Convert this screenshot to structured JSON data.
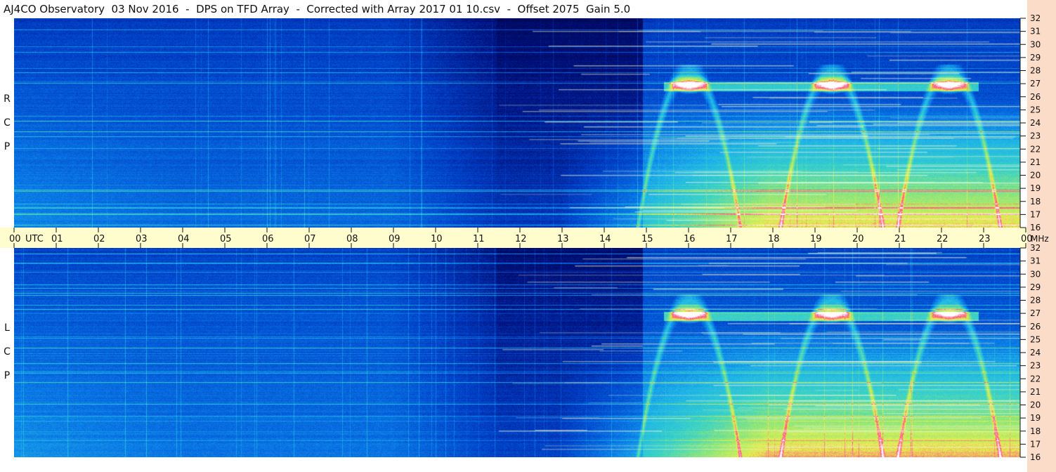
{
  "title": "AJ4CO Observatory  03 Nov 2016  -  DPS on TFD Array  -  Corrected with Array 2017 01 10.csv  -  Offset 2075  Gain 5.0",
  "chart_data": [
    {
      "type": "heatmap",
      "panel": "RCP",
      "panel_label": [
        "R",
        "C",
        "P"
      ],
      "x_axis": {
        "unit_label": "UTC",
        "range": [
          0,
          24
        ],
        "ticks": [
          "00",
          "01",
          "02",
          "03",
          "04",
          "05",
          "06",
          "07",
          "08",
          "09",
          "10",
          "11",
          "12",
          "13",
          "14",
          "15",
          "16",
          "17",
          "18",
          "19",
          "20",
          "21",
          "22",
          "23",
          "00"
        ]
      },
      "y_axis": {
        "unit_label": "MHz",
        "range": [
          16,
          32
        ],
        "ticks": [
          "16",
          "17",
          "18",
          "19",
          "20",
          "21",
          "22",
          "23",
          "24",
          "25",
          "26",
          "27",
          "28",
          "29",
          "30",
          "31",
          "32"
        ]
      },
      "features": {
        "night_floor_level": 0.2,
        "dark_minimum_hours": [
          11.5,
          15.0
        ],
        "bright_emission_band_hours": [
          13.0,
          23.5
        ],
        "persistent_line_mhz": 26.8,
        "hotspots": [
          {
            "hour": 16.1,
            "mhz": 27.0,
            "intensity": 1.0
          },
          {
            "hour": 19.5,
            "mhz": 27.0,
            "intensity": 1.0
          },
          {
            "hour": 22.3,
            "mhz": 27.0,
            "intensity": 0.95
          }
        ],
        "arcs": [
          {
            "center_hour": 16.1,
            "apex_mhz": 28.0,
            "half_width_hours": 1.0
          },
          {
            "center_hour": 19.5,
            "apex_mhz": 28.0,
            "half_width_hours": 1.0
          },
          {
            "center_hour": 22.3,
            "apex_mhz": 28.0,
            "half_width_hours": 1.0
          }
        ]
      }
    },
    {
      "type": "heatmap",
      "panel": "LCP",
      "panel_label": [
        "L",
        "C",
        "P"
      ],
      "x_axis": {
        "unit_label": "UTC",
        "range": [
          0,
          24
        ]
      },
      "y_axis": {
        "unit_label": "MHz",
        "range": [
          16,
          32
        ],
        "ticks": [
          "16",
          "17",
          "18",
          "19",
          "20",
          "21",
          "22",
          "23",
          "24",
          "25",
          "26",
          "27",
          "28",
          "29",
          "30",
          "31",
          "32"
        ]
      },
      "features": {
        "night_floor_level": 0.22,
        "dark_minimum_hours": [
          11.5,
          15.0
        ],
        "bright_emission_band_hours": [
          13.0,
          23.5
        ],
        "persistent_line_mhz": 26.8,
        "hotspots": [
          {
            "hour": 16.1,
            "mhz": 27.0,
            "intensity": 0.9
          },
          {
            "hour": 19.5,
            "mhz": 27.0,
            "intensity": 0.85
          },
          {
            "hour": 22.3,
            "mhz": 27.0,
            "intensity": 0.8
          }
        ],
        "arcs": [
          {
            "center_hour": 16.1,
            "apex_mhz": 28.0,
            "half_width_hours": 1.0
          },
          {
            "center_hour": 19.5,
            "apex_mhz": 28.0,
            "half_width_hours": 1.0
          },
          {
            "center_hour": 22.3,
            "apex_mhz": 28.0,
            "half_width_hours": 1.0
          }
        ]
      }
    }
  ],
  "x_axis_labels": {
    "utc_label": "UTC",
    "ticks": [
      "00",
      "01",
      "02",
      "03",
      "04",
      "05",
      "06",
      "07",
      "08",
      "09",
      "10",
      "11",
      "12",
      "13",
      "14",
      "15",
      "16",
      "17",
      "18",
      "19",
      "20",
      "21",
      "22",
      "23",
      "00"
    ],
    "end_unit": "MHz"
  },
  "colors": {
    "title_bg": "#ffffff",
    "time_axis_bg": "#fffccd",
    "freq_strip_bg": "#fbdcc8",
    "colormap": [
      "#000033",
      "#00107a",
      "#0040c8",
      "#0a78e6",
      "#1fb4e8",
      "#3ad2c8",
      "#8fe67a",
      "#e6f050",
      "#ff5080",
      "#ffffff"
    ]
  }
}
